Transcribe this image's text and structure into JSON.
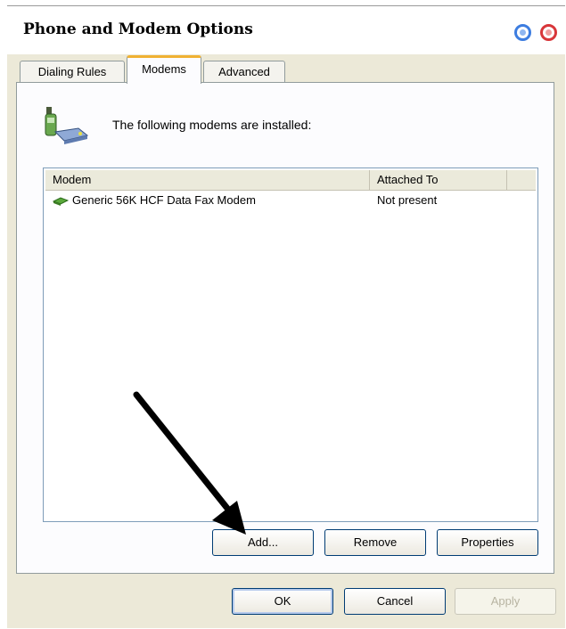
{
  "window": {
    "title": "Phone and Modem Options"
  },
  "tabs": [
    {
      "label": "Dialing Rules",
      "active": false
    },
    {
      "label": "Modems",
      "active": true
    },
    {
      "label": "Advanced",
      "active": false
    }
  ],
  "modems_panel": {
    "info_text": "The following modems are installed:",
    "columns": [
      "Modem",
      "Attached To"
    ],
    "rows": [
      {
        "modem": "Generic 56K HCF Data Fax Modem",
        "attached_to": "Not present"
      }
    ],
    "buttons": {
      "add": "Add...",
      "remove": "Remove",
      "properties": "Properties"
    }
  },
  "footer_buttons": {
    "ok": "OK",
    "cancel": "Cancel",
    "apply": "Apply"
  },
  "colors": {
    "tab_highlight": "#f0b133",
    "help_button": "#3d7de0",
    "close_button": "#d8363a"
  },
  "icons": [
    "help-icon",
    "close-icon",
    "phone-modem-icon",
    "modem-icon",
    "pointer-arrow"
  ]
}
